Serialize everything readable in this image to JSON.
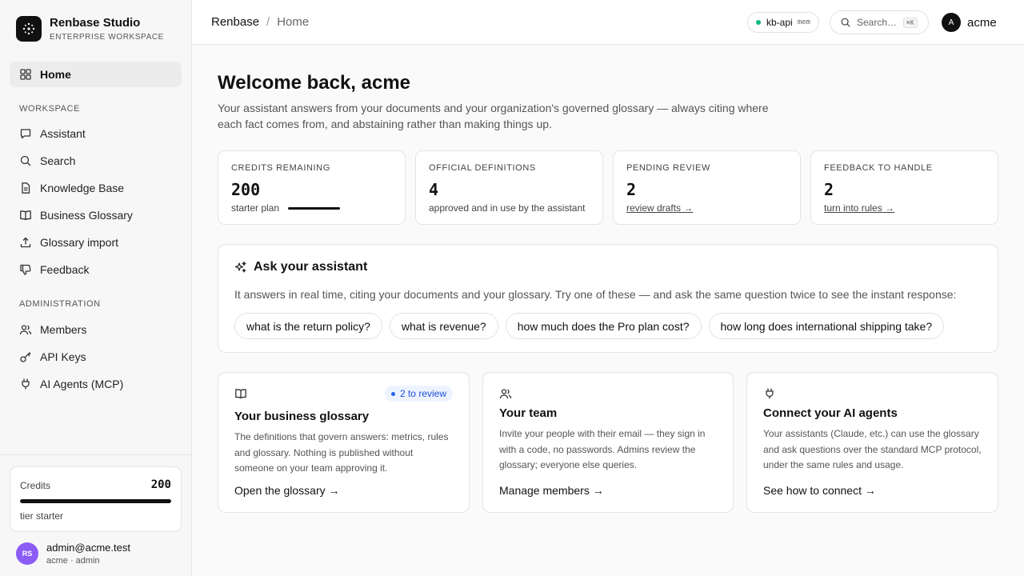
{
  "brand": {
    "name": "Renbase Studio",
    "subtitle": "ENTERPRISE WORKSPACE"
  },
  "sidebar": {
    "home": "Home",
    "workspace_heading": "WORKSPACE",
    "workspace_items": [
      {
        "label": "Assistant"
      },
      {
        "label": "Search"
      },
      {
        "label": "Knowledge Base"
      },
      {
        "label": "Business Glossary"
      },
      {
        "label": "Glossary import"
      },
      {
        "label": "Feedback"
      }
    ],
    "admin_heading": "ADMINISTRATION",
    "admin_items": [
      {
        "label": "Members"
      },
      {
        "label": "API Keys"
      },
      {
        "label": "AI Agents (MCP)"
      }
    ],
    "credits": {
      "label": "Credits",
      "value": "200",
      "tier": "tier starter",
      "fill_percent": 100
    },
    "user": {
      "initials": "RS",
      "email": "admin@acme.test",
      "org": "acme · admin",
      "avatar_color": "#8b5cf6"
    }
  },
  "header": {
    "breadcrumb_root": "Renbase",
    "breadcrumb_sep": "/",
    "breadcrumb_current": "Home",
    "api": {
      "label": "kb-api",
      "tag": "mem",
      "status_color": "#10b981"
    },
    "search": {
      "placeholder": "Search…",
      "shortcut": "⌘K"
    },
    "account": {
      "initial": "A",
      "name": "acme"
    }
  },
  "main": {
    "title": "Welcome back, acme",
    "subtitle": "Your assistant answers from your documents and your organization's governed glossary — always citing where each fact comes from, and abstaining rather than making things up.",
    "stats": [
      {
        "label": "CREDITS REMAINING",
        "value": "200",
        "note": "starter plan",
        "fill_percent": 100
      },
      {
        "label": "OFFICIAL DEFINITIONS",
        "value": "4",
        "note": "approved and in use by the assistant"
      },
      {
        "label": "PENDING REVIEW",
        "value": "2",
        "note": "review drafts →"
      },
      {
        "label": "FEEDBACK TO HANDLE",
        "value": "2",
        "note": "turn into rules →"
      }
    ],
    "ask": {
      "title": "Ask your assistant",
      "description": "It answers in real time, citing your documents and your glossary. Try one of these — and ask the same question twice to see the instant response:",
      "chips": [
        "what is the return policy?",
        "what is revenue?",
        "how much does the Pro plan cost?",
        "how long does international shipping take?"
      ]
    },
    "cards": [
      {
        "title": "Your business glossary",
        "badge": "2 to review",
        "text": "The definitions that govern answers: metrics, rules and glossary. Nothing is published without someone on your team approving it.",
        "link": "Open the glossary →"
      },
      {
        "title": "Your team",
        "text": "Invite your people with their email — they sign in with a code, no passwords. Admins review the glossary; everyone else queries.",
        "link": "Manage members →"
      },
      {
        "title": "Connect your AI agents",
        "text": "Your assistants (Claude, etc.) can use the glossary and ask questions over the standard MCP protocol, under the same rules and usage.",
        "link": "See how to connect →"
      }
    ]
  }
}
